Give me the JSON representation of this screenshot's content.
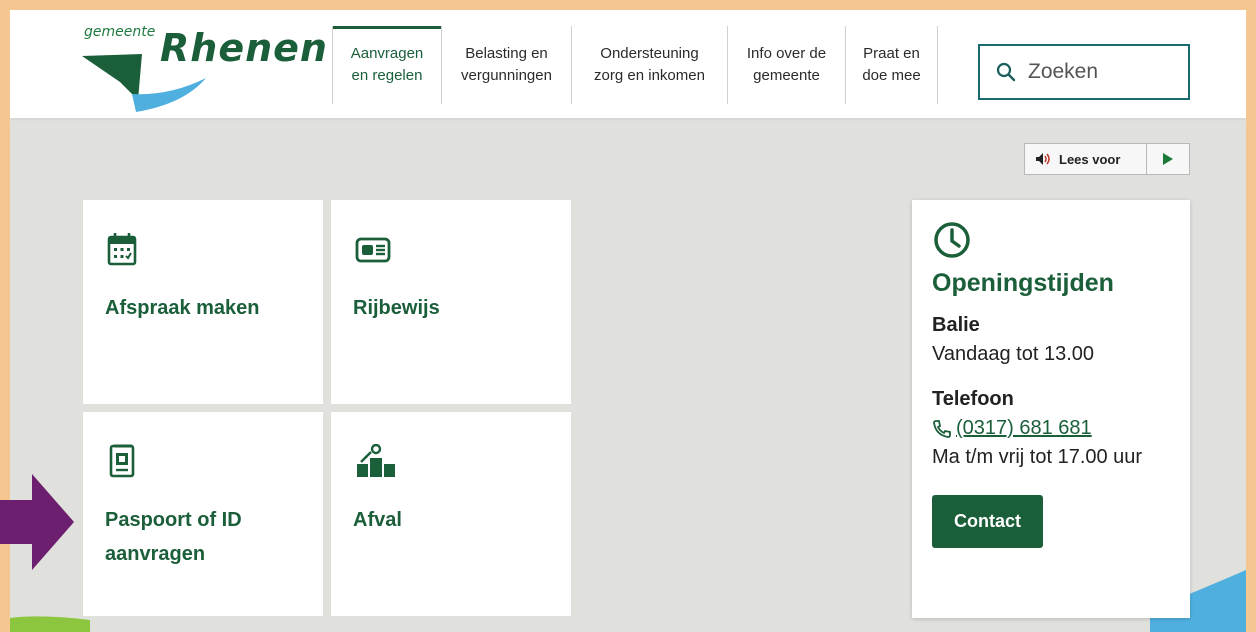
{
  "logo": {
    "small": "gemeente",
    "big": "Rhenen"
  },
  "nav": {
    "items": [
      {
        "line1": "Aanvragen",
        "line2": "en regelen"
      },
      {
        "line1": "Belasting en",
        "line2": "vergunningen"
      },
      {
        "line1": "Ondersteuning",
        "line2": "zorg en inkomen"
      },
      {
        "line1": "Info over de",
        "line2": "gemeente"
      },
      {
        "line1": "Praat en",
        "line2": "doe mee"
      }
    ]
  },
  "search": {
    "placeholder": "Zoeken"
  },
  "readspeaker": {
    "label": "Lees voor"
  },
  "tiles": [
    {
      "label": "Afspraak maken",
      "icon": "calendar-icon"
    },
    {
      "label": "Rijbewijs",
      "icon": "id-card-icon"
    },
    {
      "label": "Paspoort of ID aanvragen",
      "icon": "passport-icon"
    },
    {
      "label": "Afval",
      "icon": "waste-icon"
    }
  ],
  "openingstijden": {
    "title": "Openingstijden",
    "balie_heading": "Balie",
    "balie_text": "Vandaag tot 13.00",
    "telefoon_heading": "Telefoon",
    "telefoon_number": "(0317) 681 681",
    "telefoon_text": "Ma t/m vrij tot 17.00 uur",
    "contact_label": "Contact"
  },
  "colors": {
    "brand_green": "#1b5e3a",
    "frame_orange": "#f5c68f",
    "arrow_purple": "#6b1f6e",
    "background_grey": "#e0e0dc"
  }
}
